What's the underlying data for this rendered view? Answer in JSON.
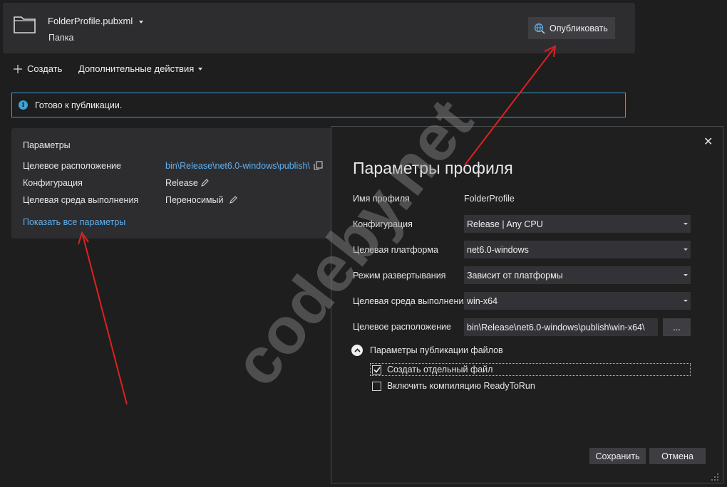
{
  "header": {
    "profile_name": "FolderProfile.pubxml",
    "profile_type": "Папка",
    "publish_label": "Опубликовать"
  },
  "toolbar": {
    "create_label": "Создать",
    "more_actions_label": "Дополнительные действия"
  },
  "info_bar": {
    "icon": "info-icon",
    "text": "Готово к публикации."
  },
  "settings": {
    "title": "Параметры",
    "rows": [
      {
        "label": "Целевое расположение",
        "value": "bin\\Release\\net6.0-windows\\publish\\",
        "action_icon": "copy-icon"
      },
      {
        "label": "Конфигурация",
        "value": "Release",
        "action_icon": "pencil-icon"
      },
      {
        "label": "Целевая среда выполнения",
        "value": "Переносимый",
        "action_icon": "pencil-icon"
      }
    ],
    "show_all_link": "Показать все параметры"
  },
  "dialog": {
    "title": "Параметры профиля",
    "close_glyph": "✕",
    "profile_name_label": "Имя профиля",
    "profile_name_value": "FolderProfile",
    "fields": [
      {
        "label": "Конфигурация",
        "value": "Release | Any CPU"
      },
      {
        "label": "Целевая платформа",
        "value": "net6.0-windows"
      },
      {
        "label": "Режим развертывания",
        "value": "Зависит от платформы"
      },
      {
        "label": "Целевая среда выполнения",
        "value": "win-x64"
      }
    ],
    "location_label": "Целевое расположение",
    "location_value": "bin\\Release\\net6.0-windows\\publish\\win-x64\\",
    "browse_label": "...",
    "file_options_title": "Параметры публикации файлов",
    "checkboxes": [
      {
        "label": "Создать отдельный файл",
        "checked": true
      },
      {
        "label": "Включить компиляцию ReadyToRun",
        "checked": false
      }
    ],
    "save_label": "Сохранить",
    "cancel_label": "Отмена"
  },
  "watermark": "codeby.net",
  "colors": {
    "background": "#1e1e1e",
    "panel": "#2d2d30",
    "link": "#5fb0ee",
    "info_accent": "#3ba3d9",
    "annotation_arrow": "#e02020"
  }
}
